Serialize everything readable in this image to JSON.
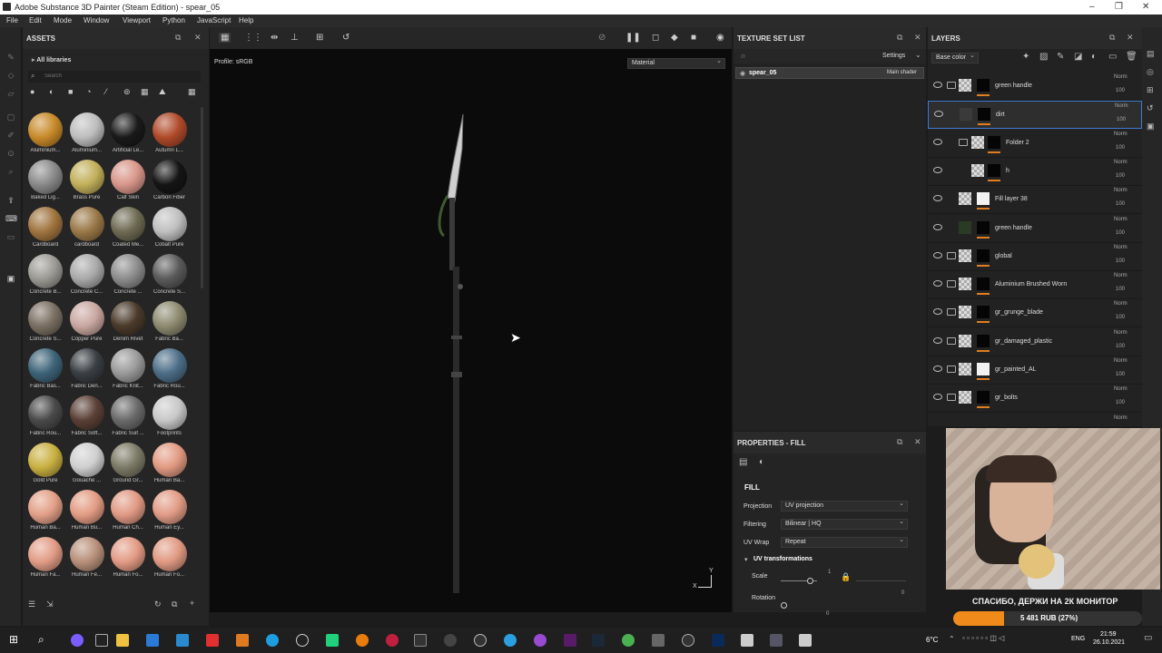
{
  "window": {
    "title": "Adobe Substance 3D Painter (Steam Edition) - spear_05",
    "minimize": "–",
    "maximize": "❐",
    "close": "✕"
  },
  "menu": [
    "File",
    "Edit",
    "Mode",
    "Window",
    "Viewport",
    "Python",
    "JavaScript",
    "Help"
  ],
  "assets": {
    "title": "ASSETS",
    "library": "All libraries",
    "search_placeholder": "Search",
    "materials": [
      {
        "label": "Aluminium...",
        "color": "#c88a2a"
      },
      {
        "label": "Aluminium...",
        "color": "#bdbdbd"
      },
      {
        "label": "Artificial Le...",
        "color": "#1a1a1a"
      },
      {
        "label": "Autumn L...",
        "color": "#b04a2a"
      },
      {
        "label": "Baked Lig...",
        "color": "#8a8a8a"
      },
      {
        "label": "Brass Pure",
        "color": "#c2b05a"
      },
      {
        "label": "Calf Skin",
        "color": "#d9968a"
      },
      {
        "label": "Carbon Fiber",
        "color": "#151515"
      },
      {
        "label": "Cardboard",
        "color": "#a0743f"
      },
      {
        "label": "cardboard",
        "color": "#9a7848"
      },
      {
        "label": "Coated Me...",
        "color": "#6e6a52"
      },
      {
        "label": "Cobalt Pure",
        "color": "#bfbfbf"
      },
      {
        "label": "Concrete B...",
        "color": "#9c9a94"
      },
      {
        "label": "Concrete C...",
        "color": "#a9a9a9"
      },
      {
        "label": "Concrete ...",
        "color": "#8c8c8c"
      },
      {
        "label": "Concrete S...",
        "color": "#5a5a5a"
      },
      {
        "label": "Concrete S...",
        "color": "#7a6f62"
      },
      {
        "label": "Copper Pure",
        "color": "#c9a7a0"
      },
      {
        "label": "Denim Rivet",
        "color": "#4a3a2a"
      },
      {
        "label": "Fabric Ba...",
        "color": "#8d8a70"
      },
      {
        "label": "Fabric Bas...",
        "color": "#3d6478"
      },
      {
        "label": "Fabric Den...",
        "color": "#3a3f44"
      },
      {
        "label": "Fabric Knit...",
        "color": "#9a9a9a"
      },
      {
        "label": "Fabric Rou...",
        "color": "#4d6e88"
      },
      {
        "label": "Fabric Rou...",
        "color": "#4a4a4a"
      },
      {
        "label": "Fabric Soft...",
        "color": "#5a4035"
      },
      {
        "label": "Fabric Suit ...",
        "color": "#6a6a6a"
      },
      {
        "label": "Footprints",
        "color": "#c8c8c8"
      },
      {
        "label": "Gold Pure",
        "color": "#c8b040"
      },
      {
        "label": "Gouache ...",
        "color": "#cfcfcf"
      },
      {
        "label": "Ground Gr...",
        "color": "#7c7a66"
      },
      {
        "label": "Human Ba...",
        "color": "#e29a82"
      },
      {
        "label": "Human Ba...",
        "color": "#e3a088"
      },
      {
        "label": "Human Bu...",
        "color": "#e39c84"
      },
      {
        "label": "Human Ch...",
        "color": "#e19a84"
      },
      {
        "label": "Human Ey...",
        "color": "#e29b86"
      },
      {
        "label": "Human Fa...",
        "color": "#e29c86"
      },
      {
        "label": "Human Fe...",
        "color": "#b8907a"
      },
      {
        "label": "Human Fo...",
        "color": "#e39b85"
      },
      {
        "label": "Human Fo...",
        "color": "#e19a83"
      }
    ]
  },
  "viewport": {
    "profile": "Profile: sRGB",
    "material_mode": "Material",
    "axis_y": "Y",
    "axis_x": "X"
  },
  "texture_set": {
    "title": "TEXTURE SET LIST",
    "settings": "Settings",
    "set_name": "spear_05",
    "shader": "Main shader"
  },
  "layers": {
    "title": "LAYERS",
    "channel": "Base color",
    "rows": [
      {
        "name": "green handle",
        "norm": "Norm",
        "pct": "100",
        "folder": true
      },
      {
        "name": "dirt",
        "norm": "Norm",
        "pct": "100",
        "folder": false
      },
      {
        "name": "Folder 2",
        "norm": "Norm",
        "pct": "100",
        "folder": true
      },
      {
        "name": "h",
        "norm": "Norm",
        "pct": "100",
        "folder": false
      },
      {
        "name": "Fill layer 38",
        "norm": "Norm",
        "pct": "100",
        "folder": false
      },
      {
        "name": "green handle",
        "norm": "Norm",
        "pct": "100",
        "folder": false
      },
      {
        "name": "global",
        "norm": "Norm",
        "pct": "100",
        "folder": true
      },
      {
        "name": "Aluminium Brushed Worn",
        "norm": "Norm",
        "pct": "100",
        "folder": true
      },
      {
        "name": "gr_grunge_blade",
        "norm": "Norm",
        "pct": "100",
        "folder": true
      },
      {
        "name": "gr_damaged_plastic",
        "norm": "Norm",
        "pct": "100",
        "folder": true
      },
      {
        "name": "gr_painted_AL",
        "norm": "Norm",
        "pct": "100",
        "folder": true
      },
      {
        "name": "gr_bolts",
        "norm": "Norm",
        "pct": "100",
        "folder": true
      }
    ],
    "last_norm": "Norm"
  },
  "properties": {
    "title": "PROPERTIES - FILL",
    "section": "FILL",
    "projection_label": "Projection",
    "projection_value": "UV projection",
    "filtering_label": "Filtering",
    "filtering_value": "Bilinear | HQ",
    "uvwrap_label": "UV Wrap",
    "uvwrap_value": "Repeat",
    "uvt_label": "UV transformations",
    "scale_label": "Scale",
    "scale_value": "1",
    "rotation_label": "Rotation",
    "rotation_value": "0",
    "right_value": "0"
  },
  "overlay": {
    "message": "СПАСИБО, ДЕРЖИ НА 2К МОНИТОР",
    "donation": "5 481 RUB (27%)",
    "donation_progress": 0.27
  },
  "taskbar": {
    "weather": "6°C",
    "time": "21:59",
    "date": "26.10.2021",
    "lang": "ENG"
  }
}
